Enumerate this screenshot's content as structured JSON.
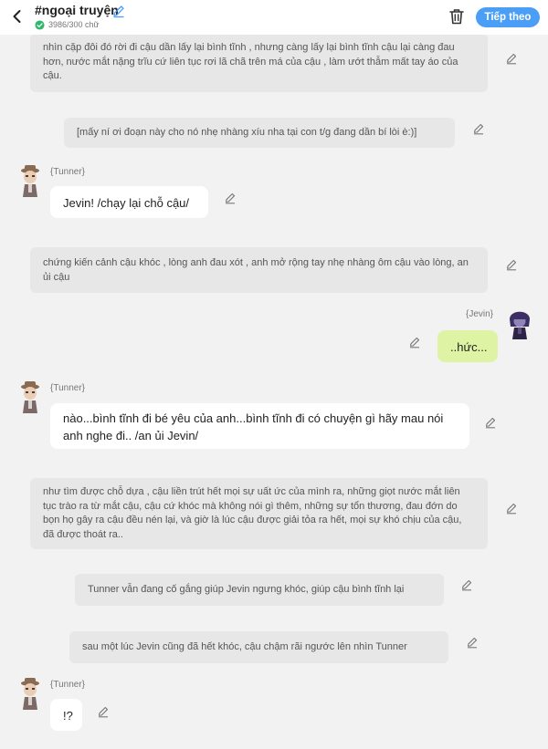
{
  "header": {
    "title": "#ngoại truyện",
    "word_count": "3986/300 chữ",
    "next_label": "Tiếp theo",
    "accent": "#4a9ef6"
  },
  "messages": {
    "m1": "nhìn cặp đôi đó rời đi cậu dần lấy lại bình tĩnh , nhưng càng lấy lại bình tĩnh cậu lại càng đau hơn, nước mắt nặng trĩu cứ liên tục rơi lã chã trên má của cậu , làm ướt thẫm mất tay áo của cậu.",
    "m2": "[mấy ní ơi đoạn này cho nó nhẹ nhàng xíu nha tại con t/g đang dần bí lòi è:)]",
    "m3_speaker": "{Tunner}",
    "m3": "Jevin! /chạy lại chỗ cậu/",
    "m4": "chứng kiến cảnh cậu khóc , lòng anh đau xót , anh mở rộng tay nhẹ nhàng ôm cậu vào lòng, an ủi cậu",
    "m5_speaker": "{Jevin}",
    "m5": "..hức...",
    "m6_speaker": "{Tunner}",
    "m6": "nào...bình tĩnh đi bé yêu của anh...bình tĩnh đi có chuyện gì hãy mau nói anh nghe đi.. /an ủi Jevin/",
    "m7": "như tìm được chỗ dựa , cậu liền trút hết mọi sự uất ức của mình ra, những giọt nước mắt liên tục trào ra từ mắt cậu, cậu cứ khóc mà không nói gì thêm, những sự tổn thương, đau đớn do bọn họ gây ra cậu đều nén lại, và giờ là lúc cậu được giải tỏa ra hết, mọi sự khó chịu của cậu, đã được thoát ra..",
    "m8": "Tunner vẫn đang cố gắng giúp Jevin ngưng khóc, giúp cậu bình tĩnh lại",
    "m9": "sau một lúc Jevin cũng đã hết khóc, cậu chậm rãi ngước lên nhìn Tunner",
    "m10_speaker": "{Tunner}",
    "m10": "!?"
  },
  "icons": {
    "back": "chevron-left-icon",
    "edit": "pencil-icon",
    "trash": "trash-icon",
    "check": "check-circle-icon"
  }
}
